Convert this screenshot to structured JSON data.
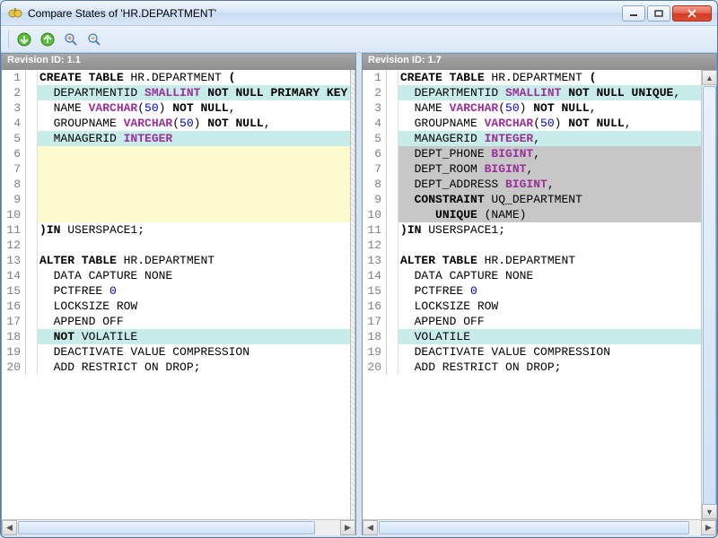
{
  "window": {
    "title": "Compare States of 'HR.DEPARTMENT'"
  },
  "toolbar": {
    "icons": [
      "next-diff-icon",
      "prev-diff-icon",
      "zoom-in-icon",
      "zoom-out-icon"
    ]
  },
  "left": {
    "header": "Revision ID: 1.1",
    "lines": [
      {
        "n": 1,
        "hl": "",
        "tokens": [
          [
            "kw",
            "CREATE TABLE"
          ],
          [
            "",
            " HR.DEPARTMENT "
          ],
          [
            "kw",
            "("
          ]
        ]
      },
      {
        "n": 2,
        "hl": "hl-diff",
        "tokens": [
          [
            "",
            "  DEPARTMENTID "
          ],
          [
            "tp",
            "SMALLINT"
          ],
          [
            "",
            " "
          ],
          [
            "kw",
            "NOT"
          ],
          [
            "",
            " "
          ],
          [
            "kw",
            "NULL"
          ],
          [
            "",
            " "
          ],
          [
            "kw",
            "PRIMARY KEY"
          ]
        ]
      },
      {
        "n": 3,
        "hl": "",
        "tokens": [
          [
            "",
            "  NAME "
          ],
          [
            "tp",
            "VARCHAR"
          ],
          [
            "",
            "("
          ],
          [
            "num",
            "50"
          ],
          [
            "",
            ") "
          ],
          [
            "kw",
            "NOT"
          ],
          [
            "",
            " "
          ],
          [
            "kw",
            "NULL"
          ],
          [
            "",
            ","
          ]
        ]
      },
      {
        "n": 4,
        "hl": "",
        "tokens": [
          [
            "",
            "  GROUPNAME "
          ],
          [
            "tp",
            "VARCHAR"
          ],
          [
            "",
            "("
          ],
          [
            "num",
            "50"
          ],
          [
            "",
            ") "
          ],
          [
            "kw",
            "NOT"
          ],
          [
            "",
            " "
          ],
          [
            "kw",
            "NULL"
          ],
          [
            "",
            ","
          ]
        ]
      },
      {
        "n": 5,
        "hl": "hl-diff",
        "tokens": [
          [
            "",
            "  MANAGERID "
          ],
          [
            "tp",
            "INTEGER"
          ]
        ]
      },
      {
        "n": 6,
        "hl": "hl-empty",
        "tokens": [
          [
            "",
            ""
          ]
        ]
      },
      {
        "n": 7,
        "hl": "hl-empty",
        "tokens": [
          [
            "",
            ""
          ]
        ]
      },
      {
        "n": 8,
        "hl": "hl-empty",
        "tokens": [
          [
            "",
            ""
          ]
        ]
      },
      {
        "n": 9,
        "hl": "hl-empty",
        "tokens": [
          [
            "",
            ""
          ]
        ]
      },
      {
        "n": 10,
        "hl": "hl-empty",
        "tokens": [
          [
            "",
            ""
          ]
        ]
      },
      {
        "n": 11,
        "hl": "",
        "tokens": [
          [
            "kw",
            ")"
          ],
          [
            "kw",
            "IN"
          ],
          [
            "",
            " USERSPACE1;"
          ]
        ]
      },
      {
        "n": 12,
        "hl": "",
        "tokens": [
          [
            "",
            ""
          ]
        ]
      },
      {
        "n": 13,
        "hl": "",
        "tokens": [
          [
            "kw",
            "ALTER TABLE"
          ],
          [
            "",
            " HR.DEPARTMENT"
          ]
        ]
      },
      {
        "n": 14,
        "hl": "",
        "tokens": [
          [
            "",
            "  DATA CAPTURE NONE"
          ]
        ]
      },
      {
        "n": 15,
        "hl": "",
        "tokens": [
          [
            "",
            "  PCTFREE "
          ],
          [
            "num",
            "0"
          ]
        ]
      },
      {
        "n": 16,
        "hl": "",
        "tokens": [
          [
            "",
            "  LOCKSIZE ROW"
          ]
        ]
      },
      {
        "n": 17,
        "hl": "",
        "tokens": [
          [
            "",
            "  APPEND OFF"
          ]
        ]
      },
      {
        "n": 18,
        "hl": "hl-diff",
        "tokens": [
          [
            "",
            "  "
          ],
          [
            "kw",
            "NOT"
          ],
          [
            "",
            " VOLATILE"
          ]
        ]
      },
      {
        "n": 19,
        "hl": "",
        "tokens": [
          [
            "",
            "  DEACTIVATE VALUE COMPRESSION"
          ]
        ]
      },
      {
        "n": 20,
        "hl": "",
        "tokens": [
          [
            "",
            "  ADD RESTRICT ON DROP;"
          ]
        ]
      }
    ]
  },
  "right": {
    "header": "Revision ID: 1.7",
    "lines": [
      {
        "n": 1,
        "hl": "",
        "tokens": [
          [
            "kw",
            "CREATE TABLE"
          ],
          [
            "",
            " HR.DEPARTMENT "
          ],
          [
            "kw",
            "("
          ]
        ]
      },
      {
        "n": 2,
        "hl": "hl-diff",
        "tokens": [
          [
            "",
            "  DEPARTMENTID "
          ],
          [
            "tp",
            "SMALLINT"
          ],
          [
            "",
            " "
          ],
          [
            "kw",
            "NOT"
          ],
          [
            "",
            " "
          ],
          [
            "kw",
            "NULL"
          ],
          [
            "",
            " "
          ],
          [
            "kw",
            "UNIQUE"
          ],
          [
            "",
            ","
          ]
        ]
      },
      {
        "n": 3,
        "hl": "",
        "tokens": [
          [
            "",
            "  NAME "
          ],
          [
            "tp",
            "VARCHAR"
          ],
          [
            "",
            "("
          ],
          [
            "num",
            "50"
          ],
          [
            "",
            ") "
          ],
          [
            "kw",
            "NOT"
          ],
          [
            "",
            " "
          ],
          [
            "kw",
            "NULL"
          ],
          [
            "",
            ","
          ]
        ]
      },
      {
        "n": 4,
        "hl": "",
        "tokens": [
          [
            "",
            "  GROUPNAME "
          ],
          [
            "tp",
            "VARCHAR"
          ],
          [
            "",
            "("
          ],
          [
            "num",
            "50"
          ],
          [
            "",
            ") "
          ],
          [
            "kw",
            "NOT"
          ],
          [
            "",
            " "
          ],
          [
            "kw",
            "NULL"
          ],
          [
            "",
            ","
          ]
        ]
      },
      {
        "n": 5,
        "hl": "hl-diff",
        "tokens": [
          [
            "",
            "  MANAGERID "
          ],
          [
            "tp",
            "INTEGER"
          ],
          [
            "",
            ","
          ]
        ]
      },
      {
        "n": 6,
        "hl": "hl-ins",
        "tokens": [
          [
            "",
            "  DEPT_PHONE "
          ],
          [
            "tp",
            "BIGINT"
          ],
          [
            "",
            ","
          ]
        ]
      },
      {
        "n": 7,
        "hl": "hl-ins",
        "tokens": [
          [
            "",
            "  DEPT_ROOM "
          ],
          [
            "tp",
            "BIGINT"
          ],
          [
            "",
            ","
          ]
        ]
      },
      {
        "n": 8,
        "hl": "hl-ins",
        "tokens": [
          [
            "",
            "  DEPT_ADDRESS "
          ],
          [
            "tp",
            "BIGINT"
          ],
          [
            "",
            ","
          ]
        ]
      },
      {
        "n": 9,
        "hl": "hl-ins",
        "tokens": [
          [
            "",
            "  "
          ],
          [
            "kw",
            "CONSTRAINT"
          ],
          [
            "",
            " UQ_DEPARTMENT"
          ]
        ]
      },
      {
        "n": 10,
        "hl": "hl-ins",
        "tokens": [
          [
            "",
            "     "
          ],
          [
            "kw",
            "UNIQUE"
          ],
          [
            "",
            " (NAME)"
          ]
        ]
      },
      {
        "n": 11,
        "hl": "",
        "tokens": [
          [
            "kw",
            ")"
          ],
          [
            "kw",
            "IN"
          ],
          [
            "",
            " USERSPACE1;"
          ]
        ]
      },
      {
        "n": 12,
        "hl": "",
        "tokens": [
          [
            "",
            ""
          ]
        ]
      },
      {
        "n": 13,
        "hl": "",
        "tokens": [
          [
            "kw",
            "ALTER TABLE"
          ],
          [
            "",
            " HR.DEPARTMENT"
          ]
        ]
      },
      {
        "n": 14,
        "hl": "",
        "tokens": [
          [
            "",
            "  DATA CAPTURE NONE"
          ]
        ]
      },
      {
        "n": 15,
        "hl": "",
        "tokens": [
          [
            "",
            "  PCTFREE "
          ],
          [
            "num",
            "0"
          ]
        ]
      },
      {
        "n": 16,
        "hl": "",
        "tokens": [
          [
            "",
            "  LOCKSIZE ROW"
          ]
        ]
      },
      {
        "n": 17,
        "hl": "",
        "tokens": [
          [
            "",
            "  APPEND OFF"
          ]
        ]
      },
      {
        "n": 18,
        "hl": "hl-diff",
        "tokens": [
          [
            "",
            "  VOLATILE"
          ]
        ]
      },
      {
        "n": 19,
        "hl": "",
        "tokens": [
          [
            "",
            "  DEACTIVATE VALUE COMPRESSION"
          ]
        ]
      },
      {
        "n": 20,
        "hl": "",
        "tokens": [
          [
            "",
            "  ADD RESTRICT ON DROP;"
          ]
        ]
      }
    ]
  },
  "scroll": {
    "left_thumb_pct": 92,
    "right_thumb_pct": 96,
    "v_thumb_pct": 100
  }
}
